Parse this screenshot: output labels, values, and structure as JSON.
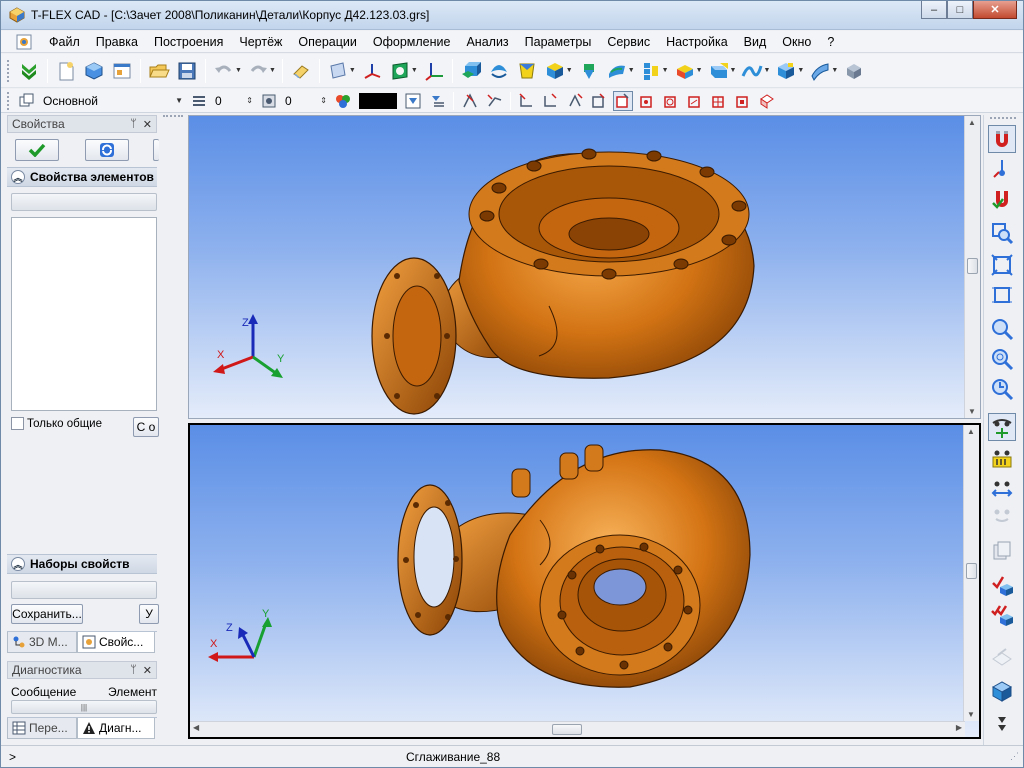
{
  "window": {
    "title": "T-FLEX CAD - [C:\\Зачет 2008\\Поликанин\\Детали\\Корпус Д42.123.03.grs]",
    "minimize": "–",
    "maximize": "□",
    "close": "✕"
  },
  "menu": {
    "items": [
      "Файл",
      "Правка",
      "Построения",
      "Чертёж",
      "Операции",
      "Оформление",
      "Анализ",
      "Параметры",
      "Сервис",
      "Настройка",
      "Вид",
      "Окно",
      "?"
    ],
    "mdi_min": "–",
    "mdi_restore": "⧉",
    "mdi_close": "✕"
  },
  "toolbar2": {
    "layer_value": "Основной",
    "spin1_value": "0",
    "spin2_value": "0",
    "color_value": "#000000"
  },
  "left_panel": {
    "title": "Свойства",
    "pin": "ㅁ",
    "close": "✕",
    "properties_section": "Свойства элементов",
    "only_common_label": "Только общие",
    "partial_button": "С о",
    "sets_section": "Наборы свойств",
    "save_button": "Сохранить...",
    "partial_button2": "У",
    "tabs": [
      "3D М...",
      "Свойс..."
    ]
  },
  "diagnostics": {
    "title": "Диагностика",
    "col_message": "Сообщение",
    "col_element": "Элемент",
    "tabs": [
      "Пере...",
      "Диагн..."
    ]
  },
  "viewports": {
    "axis_labels": {
      "x": "X",
      "y": "Y",
      "z": "Z"
    },
    "part_color": "#c8640a",
    "bg_top": "#5a8ee6"
  },
  "status": {
    "prompt": ">",
    "text": "Сглаживание_88"
  }
}
